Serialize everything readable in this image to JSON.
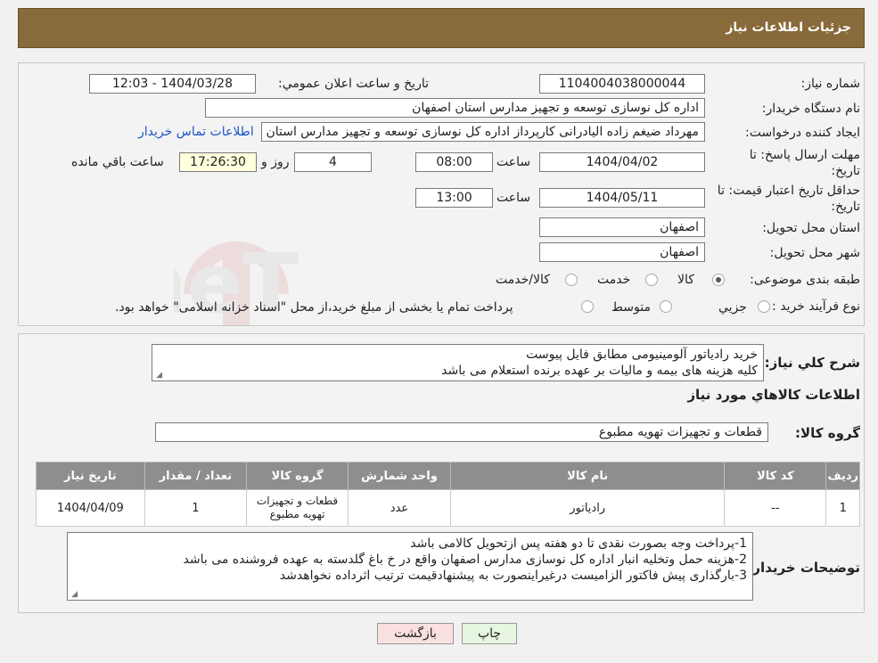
{
  "header": {
    "title": "جزئیات اطلاعات نیاز"
  },
  "fields": {
    "need_number_label": "شماره نیاز:",
    "need_number": "1104004038000044",
    "announce_label": "تاريخ و ساعت اعلان عمومي:",
    "announce_value": "1404/03/28 - 12:03",
    "buyer_org_label": "نام دستگاه خریدار:",
    "buyer_org": "اداره کل نوسازی  توسعه و تجهیز مدارس استان اصفهان",
    "creator_label": "ایجاد کننده درخواست:",
    "creator": "مهرداد ضیغم زاده الیادرانی کارپرداز اداره کل نوسازی  توسعه و تجهیز مدارس استان اصفهان",
    "contact_link": "اطلاعات تماس خریدار",
    "deadline_label_1": "مهلت ارسال پاسخ: تا",
    "deadline_label_2": "تاریخ:",
    "deadline_date": "1404/04/02",
    "time_label": "ساعت",
    "deadline_time": "08:00",
    "days_value": "4",
    "days_label": "روز و",
    "remaining_time": "17:26:30",
    "remaining_label": "ساعت باقي مانده",
    "validity_label_1": "حداقل تاریخ اعتبار قیمت: تا",
    "validity_label_2": "تاریخ:",
    "validity_date": "1404/05/11",
    "validity_time": "13:00",
    "province_label": "استان محل تحویل:",
    "province": "اصفهان",
    "city_label": "شهر محل تحویل:",
    "city": "اصفهان",
    "category_label": "طبقه بندی موضوعی:",
    "category_options": [
      "کالا",
      "خدمت",
      "کالا/خدمت"
    ],
    "category_selected": 0,
    "process_label": "نوع فرآیند خرید :",
    "process_options": [
      "جزیي",
      "متوسط"
    ],
    "process_note": "پرداخت تمام یا بخشی از مبلغ خرید،از محل \"اسناد خزانه اسلامی\" خواهد بود."
  },
  "summary": {
    "label": "شرح کلي نياز:",
    "lines": [
      "خرید رادیاتور آلومینیومی مطابق فایل پیوست",
      "کلیه هزینه های بیمه و مالیات بر عهده برنده استعلام می باشد"
    ]
  },
  "goods": {
    "section_title": "اطلاعات کالاهاي مورد نياز",
    "group_label": "گروه کالا:",
    "group_value": "قطعات و تجهیزات تهویه مطبوع",
    "columns": [
      "ردیف",
      "کد کالا",
      "نام کالا",
      "واحد شمارش",
      "گروه کالا",
      "تعداد / مقدار",
      "تاریخ نیاز"
    ],
    "rows": [
      [
        "1",
        "--",
        "رادیاتور",
        "عدد",
        "قطعات و تجهیزات تهویه مطبوع",
        "1",
        "1404/04/09"
      ]
    ]
  },
  "buyer_notes": {
    "label": "توضیحات خریدار:",
    "lines": [
      "1-پرداخت وجه بصورت نقدی تا دو هفته پس ازتحویل کالامی باشد",
      "2-هزینه حمل وتخلیه انبار اداره کل نوسازی مدارس اصفهان واقع در خ باغ گلدسته به عهده فروشنده می باشد",
      "3-بارگذاری پیش فاکتور الزامیست درغیراینصورت به پیشنهادقیمت ترتیب اثرداده نخواهدشد"
    ]
  },
  "buttons": {
    "print": "چاپ",
    "back": "بازگشت"
  },
  "watermark": "AriaTender.neT",
  "colors": {
    "header_bg": "#896a3a",
    "table_header_bg": "#8e8e8e",
    "link": "#1a56c6",
    "back_btn_bg": "#fbe0e0",
    "print_btn_bg": "#e6f6e0"
  }
}
